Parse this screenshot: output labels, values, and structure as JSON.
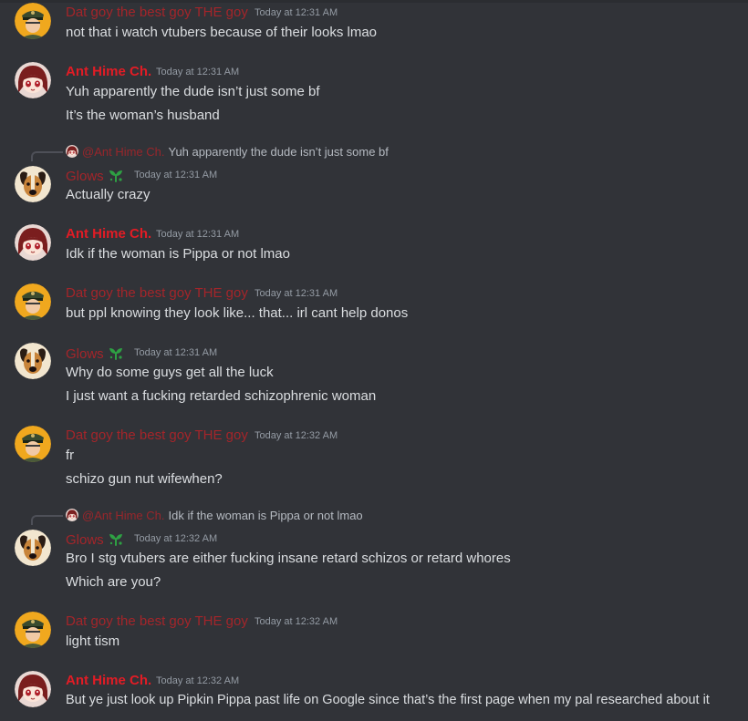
{
  "colors": {
    "background": "#313338",
    "text": "#dbdee1",
    "timestamp": "#949ba4",
    "user_dat_goy": "#a4252a",
    "user_ant_hime": "#e21c25",
    "user_glows": "#a4252a",
    "role_icon": "#2ea043"
  },
  "icons": {
    "role": "sprout-icon",
    "avatar_dat_goy": "officer-avatar",
    "avatar_ant_hime": "anime-girl-avatar",
    "avatar_glows": "dog-avatar"
  },
  "messages": [
    {
      "author": "Dat goy the best goy THE goy",
      "timestamp": "Today at 12:31 AM",
      "lines": [
        "not that i watch vtubers because of their looks lmao"
      ]
    },
    {
      "author": "Ant Hime Ch.",
      "timestamp": "Today at 12:31 AM",
      "lines": [
        "Yuh apparently the dude isn’t just some bf",
        "It’s the woman’s husband"
      ]
    },
    {
      "reply": {
        "author": "@Ant Hime Ch.",
        "text": "Yuh apparently the dude isn’t just some bf"
      },
      "author": "Glows",
      "timestamp": "Today at 12:31 AM",
      "lines": [
        "Actually crazy"
      ]
    },
    {
      "author": "Ant Hime Ch.",
      "timestamp": "Today at 12:31 AM",
      "lines": [
        "Idk if the woman is Pippa or not lmao"
      ]
    },
    {
      "author": "Dat goy the best goy THE goy",
      "timestamp": "Today at 12:31 AM",
      "lines": [
        "but ppl knowing they look like... that... irl cant help donos"
      ]
    },
    {
      "author": "Glows",
      "timestamp": "Today at 12:31 AM",
      "lines": [
        "Why do some guys get all the luck",
        "I just want a fucking retarded schizophrenic woman"
      ]
    },
    {
      "author": "Dat goy the best goy THE goy",
      "timestamp": "Today at 12:32 AM",
      "lines": [
        "fr",
        "schizo gun nut wifewhen?"
      ]
    },
    {
      "reply": {
        "author": "@Ant Hime Ch.",
        "text": "Idk if the woman is Pippa or not lmao"
      },
      "author": "Glows",
      "timestamp": "Today at 12:32 AM",
      "lines": [
        "Bro I stg vtubers are either fucking insane retard schizos or retard whores",
        "Which are you?"
      ]
    },
    {
      "author": "Dat goy the best goy THE goy",
      "timestamp": "Today at 12:32 AM",
      "lines": [
        "light tism"
      ]
    },
    {
      "author": "Ant Hime Ch.",
      "timestamp": "Today at 12:32 AM",
      "lines": [
        "But ye just look up Pipkin Pippa past life on Google since that’s the first page when my pal researched about it"
      ]
    }
  ]
}
